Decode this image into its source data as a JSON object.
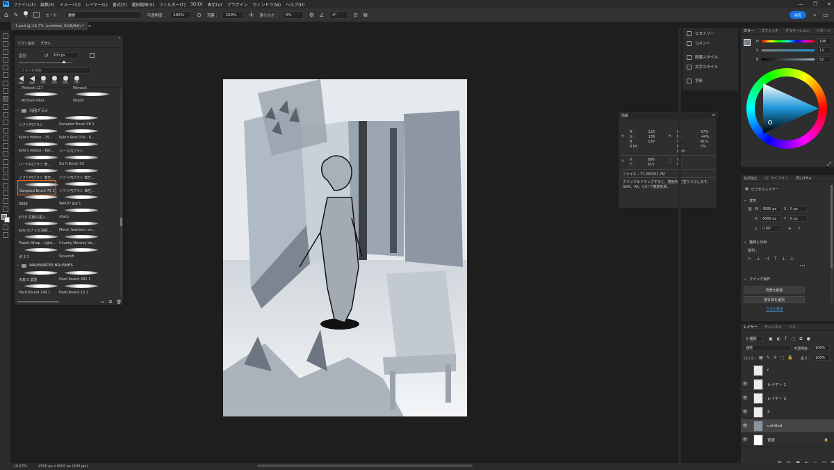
{
  "menubar": {
    "app_icon": "Ps",
    "items": [
      "ファイル(F)",
      "編集(E)",
      "イメージ(I)",
      "レイヤー(L)",
      "書式(Y)",
      "選択範囲(S)",
      "フィルター(T)",
      "3D(D)",
      "表示(V)",
      "プラグイン",
      "ウィンドウ(W)",
      "ヘルプ(H)"
    ],
    "window_controls": [
      "—",
      "❐",
      "✕"
    ]
  },
  "optbar": {
    "brush_size": "5",
    "mode_label": "モード :",
    "mode_value": "通常",
    "opacity_label": "不透明度 :",
    "opacity_value": "100%",
    "flow_label": "流量 :",
    "flow_value": "100%",
    "smoothing_label": "滑らかさ :",
    "smoothing_value": "0%",
    "angle_value": "0°",
    "share_label": "共有"
  },
  "doctab": {
    "title": "1.psd @ 16.7% (untitled, RGB/8#) *",
    "close": "×"
  },
  "brushpanel": {
    "tabs": [
      "ブラシ設定",
      "ブラシ"
    ],
    "size_label": "直径 :",
    "size_value": "300 px",
    "search_placeholder": "ブラシを検索",
    "preset_sizes": [
      "300",
      "500",
      "500",
      "500",
      "500",
      "500"
    ],
    "top_names": [
      "Pitmock L17",
      "Pitmock"
    ],
    "row0": [
      "Archive Inker",
      "Shalm"
    ],
    "group1": "汎用ブラシ",
    "cells": [
      [
        "ソフト円ブラシ",
        "Sampled Brush 28 1"
      ],
      [
        "Kyle's Inkbox - 25...",
        "Kyle's Real Oils - R..."
      ],
      [
        "Kyle's Inkbox - Bet...",
        "ハード円ブラシ"
      ],
      [
        "ハード円ブラシ 筆...",
        "Sci fi Brush V2"
      ],
      [
        "ソフト円ブラシ 筆圧...",
        "ソフト円ブラシ 筆圧..."
      ],
      [
        "Sampled Brush 75 1",
        "ソフト円ブラシ 筆圧..."
      ],
      [
        "gggg",
        "WaK07.jpg 1"
      ],
      [
        "KYLE 究極の墨入...",
        "sharp"
      ],
      [
        "Kyle のアルな油彩...",
        "Metal, feathers, an..."
      ],
      [
        "Plastic Wrap - Light...",
        "Chunky Monkey Va..."
      ],
      [
        "渋 3 1",
        "Squarish"
      ]
    ],
    "group2": "WAVEWATER BRUSHES",
    "cells2": [
      [
        "尖角 5 濃墨",
        "Hard Round 481 1"
      ],
      [
        "Hard Round 140 1",
        "Hard Round 10 1"
      ]
    ]
  },
  "history": {
    "items": [
      "ヒストリー",
      "コメント",
      "段落スタイル",
      "文字スタイル",
      "字形"
    ]
  },
  "colorpanel": {
    "tabs": [
      "カラー",
      "スウォッチ",
      "グラデーション",
      "パターン"
    ],
    "h_label": "H",
    "h_value": "196",
    "s_label": "S",
    "s_value": "13",
    "b_label": "B",
    "b_value": "52",
    "fg_color": "#76828a"
  },
  "props": {
    "tabs": [
      "色調補正",
      "CC ライブラリ",
      "プロパティ"
    ],
    "pixel_layer": "ピクセルレイヤー",
    "transform_hdr": "変形",
    "w_label": "W",
    "w_value": "4500 px",
    "x_label": "X",
    "x_value": "0 px",
    "h_label": "H",
    "h_value": "6000 px",
    "y_label": "Y",
    "y_value": "0 px",
    "angle_value": "0.00°",
    "align_hdr": "整列と分布",
    "align_sub": "整列 :",
    "quick_hdr": "クイック操作",
    "btn1": "背景を削除",
    "btn2": "被写体を選択",
    "more": "さらに表示"
  },
  "layers": {
    "tabs": [
      "レイヤー",
      "チャンネル",
      "パス"
    ],
    "filter_label": "Q 種類",
    "blend": "通常",
    "opacity_label": "不透明度 :",
    "opacity_value": "100%",
    "lock_label": "ロック :",
    "fill_label": "塗り :",
    "fill_value": "100%",
    "items": [
      {
        "name": "f",
        "visible": false
      },
      {
        "name": "レイヤー 1",
        "visible": true
      },
      {
        "name": "レイヤー 2",
        "visible": true
      },
      {
        "name": "2",
        "visible": true
      },
      {
        "name": "untitled",
        "visible": true
      },
      {
        "name": "背景",
        "visible": true
      }
    ]
  },
  "info": {
    "title": "情報",
    "r": "128",
    "g": "136",
    "b": "139",
    "c": "57%",
    "m": "44%",
    "y": "41%",
    "k": "0%",
    "bit1": "8 bit",
    "bit2": "8 bit",
    "x": "896",
    "yv": "615",
    "file": "ファイル : 77.2M/301.7M",
    "hint": "クリック＆ドラッグすると、描画色 で塗りつぶします。Shift、Alt、Ctrl で機能拡張。"
  },
  "status": {
    "zoom": "16.67%",
    "docsize": "4500 px x 6000 px (300 ppi)"
  }
}
